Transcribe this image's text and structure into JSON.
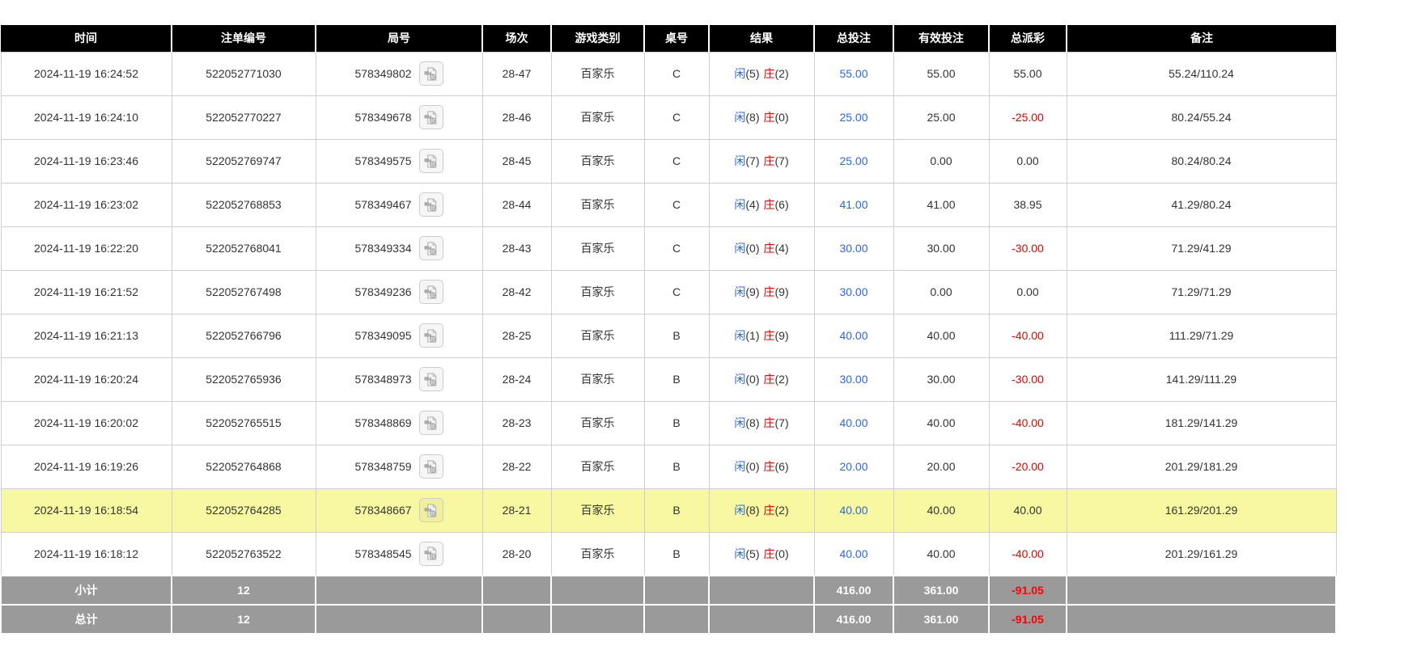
{
  "colors": {
    "player_blue": "#2b65ec",
    "banker_red": "#e60000",
    "negative_red": "#e60000",
    "footer_negative_red": "#ff0000",
    "highlight_yellow": "#f8f8a2",
    "header_bg": "#000000",
    "footer_bg": "#9a9a9a"
  },
  "icons": {
    "replay": "video-replay-icon"
  },
  "table": {
    "columns": [
      {
        "key": "time",
        "label": "时间"
      },
      {
        "key": "bet_id",
        "label": "注单编号"
      },
      {
        "key": "round_id",
        "label": "局号"
      },
      {
        "key": "session",
        "label": "场次"
      },
      {
        "key": "game_type",
        "label": "游戏类别"
      },
      {
        "key": "table_no",
        "label": "桌号"
      },
      {
        "key": "result",
        "label": "结果"
      },
      {
        "key": "total_bet",
        "label": "总投注"
      },
      {
        "key": "valid_bet",
        "label": "有效投注"
      },
      {
        "key": "total_payout",
        "label": "总派彩"
      },
      {
        "key": "remark",
        "label": "备注"
      }
    ],
    "rows": [
      {
        "time": "2024-11-19 16:24:52",
        "bet_id": "522052771030",
        "round_id": "578349802",
        "session": "28-47",
        "game_type": "百家乐",
        "table_no": "C",
        "result": {
          "player": "闲",
          "player_pts": "(5)",
          "banker": "庄",
          "banker_pts": "(2)"
        },
        "total_bet": "55.00",
        "valid_bet": "55.00",
        "total_payout": "55.00",
        "remark": "55.24/110.24",
        "highlighted": false
      },
      {
        "time": "2024-11-19 16:24:10",
        "bet_id": "522052770227",
        "round_id": "578349678",
        "session": "28-46",
        "game_type": "百家乐",
        "table_no": "C",
        "result": {
          "player": "闲",
          "player_pts": "(8)",
          "banker": "庄",
          "banker_pts": "(0)"
        },
        "total_bet": "25.00",
        "valid_bet": "25.00",
        "total_payout": "-25.00",
        "remark": "80.24/55.24",
        "highlighted": false
      },
      {
        "time": "2024-11-19 16:23:46",
        "bet_id": "522052769747",
        "round_id": "578349575",
        "session": "28-45",
        "game_type": "百家乐",
        "table_no": "C",
        "result": {
          "player": "闲",
          "player_pts": "(7)",
          "banker": "庄",
          "banker_pts": "(7)"
        },
        "total_bet": "25.00",
        "valid_bet": "0.00",
        "total_payout": "0.00",
        "remark": "80.24/80.24",
        "highlighted": false
      },
      {
        "time": "2024-11-19 16:23:02",
        "bet_id": "522052768853",
        "round_id": "578349467",
        "session": "28-44",
        "game_type": "百家乐",
        "table_no": "C",
        "result": {
          "player": "闲",
          "player_pts": "(4)",
          "banker": "庄",
          "banker_pts": "(6)"
        },
        "total_bet": "41.00",
        "valid_bet": "41.00",
        "total_payout": "38.95",
        "remark": "41.29/80.24",
        "highlighted": false
      },
      {
        "time": "2024-11-19 16:22:20",
        "bet_id": "522052768041",
        "round_id": "578349334",
        "session": "28-43",
        "game_type": "百家乐",
        "table_no": "C",
        "result": {
          "player": "闲",
          "player_pts": "(0)",
          "banker": "庄",
          "banker_pts": "(4)"
        },
        "total_bet": "30.00",
        "valid_bet": "30.00",
        "total_payout": "-30.00",
        "remark": "71.29/41.29",
        "highlighted": false
      },
      {
        "time": "2024-11-19 16:21:52",
        "bet_id": "522052767498",
        "round_id": "578349236",
        "session": "28-42",
        "game_type": "百家乐",
        "table_no": "C",
        "result": {
          "player": "闲",
          "player_pts": "(9)",
          "banker": "庄",
          "banker_pts": "(9)"
        },
        "total_bet": "30.00",
        "valid_bet": "0.00",
        "total_payout": "0.00",
        "remark": "71.29/71.29",
        "highlighted": false
      },
      {
        "time": "2024-11-19 16:21:13",
        "bet_id": "522052766796",
        "round_id": "578349095",
        "session": "28-25",
        "game_type": "百家乐",
        "table_no": "B",
        "result": {
          "player": "闲",
          "player_pts": "(1)",
          "banker": "庄",
          "banker_pts": "(9)"
        },
        "total_bet": "40.00",
        "valid_bet": "40.00",
        "total_payout": "-40.00",
        "remark": "111.29/71.29",
        "highlighted": false
      },
      {
        "time": "2024-11-19 16:20:24",
        "bet_id": "522052765936",
        "round_id": "578348973",
        "session": "28-24",
        "game_type": "百家乐",
        "table_no": "B",
        "result": {
          "player": "闲",
          "player_pts": "(0)",
          "banker": "庄",
          "banker_pts": "(2)"
        },
        "total_bet": "30.00",
        "valid_bet": "30.00",
        "total_payout": "-30.00",
        "remark": "141.29/111.29",
        "highlighted": false
      },
      {
        "time": "2024-11-19 16:20:02",
        "bet_id": "522052765515",
        "round_id": "578348869",
        "session": "28-23",
        "game_type": "百家乐",
        "table_no": "B",
        "result": {
          "player": "闲",
          "player_pts": "(8)",
          "banker": "庄",
          "banker_pts": "(7)"
        },
        "total_bet": "40.00",
        "valid_bet": "40.00",
        "total_payout": "-40.00",
        "remark": "181.29/141.29",
        "highlighted": false
      },
      {
        "time": "2024-11-19 16:19:26",
        "bet_id": "522052764868",
        "round_id": "578348759",
        "session": "28-22",
        "game_type": "百家乐",
        "table_no": "B",
        "result": {
          "player": "闲",
          "player_pts": "(0)",
          "banker": "庄",
          "banker_pts": "(6)"
        },
        "total_bet": "20.00",
        "valid_bet": "20.00",
        "total_payout": "-20.00",
        "remark": "201.29/181.29",
        "highlighted": false
      },
      {
        "time": "2024-11-19 16:18:54",
        "bet_id": "522052764285",
        "round_id": "578348667",
        "session": "28-21",
        "game_type": "百家乐",
        "table_no": "B",
        "result": {
          "player": "闲",
          "player_pts": "(8)",
          "banker": "庄",
          "banker_pts": "(2)"
        },
        "total_bet": "40.00",
        "valid_bet": "40.00",
        "total_payout": "40.00",
        "remark": "161.29/201.29",
        "highlighted": true
      },
      {
        "time": "2024-11-19 16:18:12",
        "bet_id": "522052763522",
        "round_id": "578348545",
        "session": "28-20",
        "game_type": "百家乐",
        "table_no": "B",
        "result": {
          "player": "闲",
          "player_pts": "(5)",
          "banker": "庄",
          "banker_pts": "(0)"
        },
        "total_bet": "40.00",
        "valid_bet": "40.00",
        "total_payout": "-40.00",
        "remark": "201.29/161.29",
        "highlighted": false
      }
    ],
    "footer": [
      {
        "label": "小计",
        "count": "12",
        "total_bet": "416.00",
        "valid_bet": "361.00",
        "total_payout": "-91.05"
      },
      {
        "label": "总计",
        "count": "12",
        "total_bet": "416.00",
        "valid_bet": "361.00",
        "total_payout": "-91.05"
      }
    ]
  }
}
